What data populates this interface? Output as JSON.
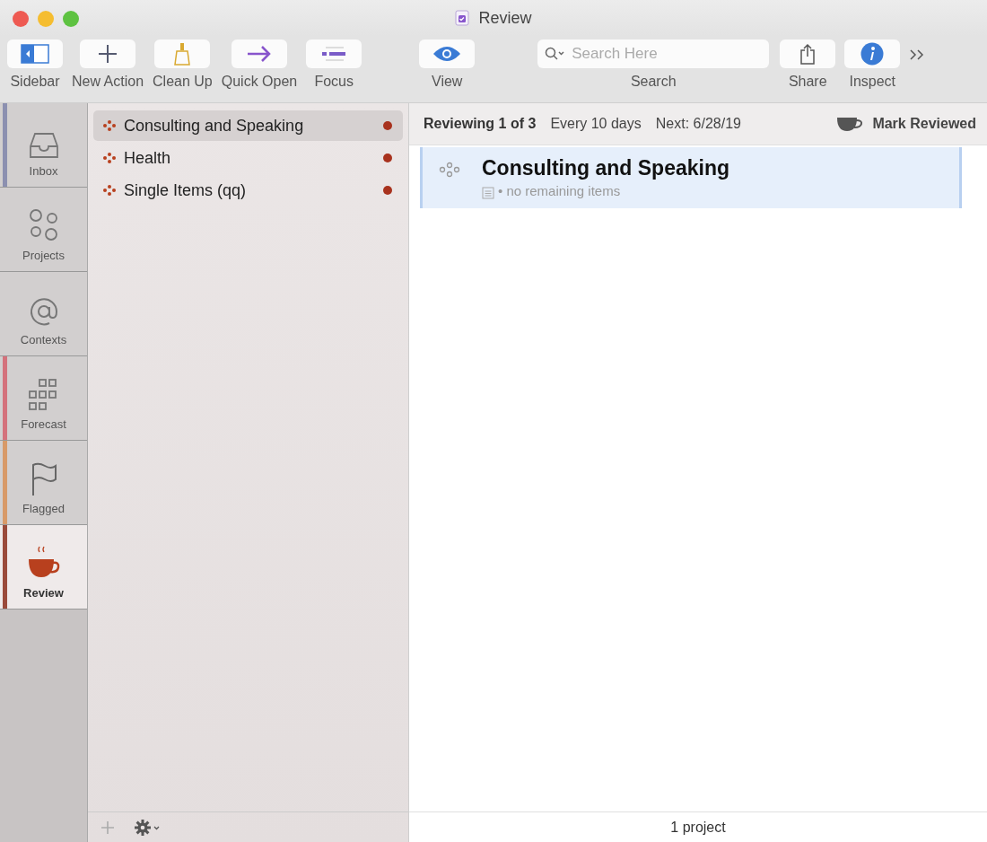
{
  "window": {
    "title": "Review"
  },
  "toolbar": [
    {
      "kind": "button",
      "label": "Sidebar"
    },
    {
      "kind": "button",
      "label": "New Action"
    },
    {
      "kind": "button",
      "label": "Clean Up"
    },
    {
      "kind": "button",
      "label": "Quick Open"
    },
    {
      "kind": "button",
      "label": "Focus"
    },
    {
      "kind": "button",
      "label": "View"
    },
    {
      "kind": "search",
      "label": "Search",
      "placeholder": "Search Here"
    },
    {
      "kind": "button",
      "label": "Share"
    },
    {
      "kind": "button",
      "label": "Inspect"
    }
  ],
  "perspectives": [
    {
      "label": "Inbox",
      "selected": false,
      "color": "#8c90b0"
    },
    {
      "label": "Projects",
      "selected": false
    },
    {
      "label": "Contexts",
      "selected": false
    },
    {
      "label": "Forecast",
      "selected": false,
      "color": "#d4727c"
    },
    {
      "label": "Flagged",
      "selected": false,
      "color": "#d89a68"
    },
    {
      "label": "Review",
      "selected": true,
      "color": "#9a4a3a"
    }
  ],
  "sidebar": {
    "items": [
      {
        "label": "Consulting and Speaking",
        "selected": true
      },
      {
        "label": "Health",
        "selected": false
      },
      {
        "label": "Single Items (qq)",
        "selected": false
      }
    ]
  },
  "review_bar": {
    "status": "Reviewing 1 of 3",
    "interval": "Every 10 days",
    "next": "Next: 6/28/19",
    "button": "Mark Reviewed"
  },
  "projects": [
    {
      "title": "Consulting and Speaking",
      "note": "• no remaining items",
      "selected": true
    }
  ],
  "status_bar": "1 project"
}
